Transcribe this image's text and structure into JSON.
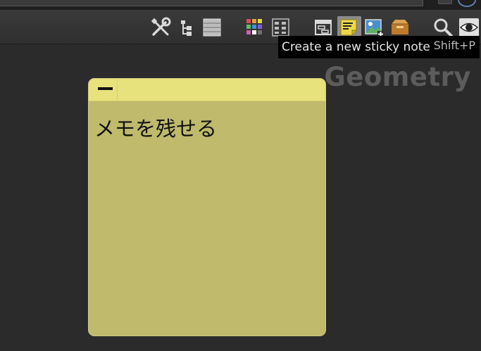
{
  "toolbar": {
    "icons": [
      {
        "name": "wrench-screwdriver-icon",
        "label": "Tools"
      },
      {
        "name": "tree-view-icon",
        "label": "Tree view"
      },
      {
        "name": "list-view-icon",
        "label": "List view"
      },
      {
        "name": "color-palette-icon",
        "label": "Color palette"
      },
      {
        "name": "shape-palette-icon",
        "label": "Shape palette"
      },
      {
        "name": "network-box-icon",
        "label": "Network box"
      },
      {
        "name": "sticky-note-icon",
        "label": "Sticky note",
        "active": true
      },
      {
        "name": "background-image-icon",
        "label": "Background image"
      },
      {
        "name": "package-box-icon",
        "label": "Package"
      },
      {
        "name": "magnifier-icon",
        "label": "Find"
      },
      {
        "name": "eye-icon",
        "label": "Display"
      }
    ]
  },
  "tooltip": {
    "text": "Create a new sticky note",
    "shortcut": "Shift+P"
  },
  "network": {
    "context_label": "Geometry"
  },
  "sticky_note": {
    "text": "メモを残せる",
    "header_color": "#e8e27c",
    "body_color": "#bfba6c"
  },
  "colors": {
    "background": "#2b2b2b",
    "toolbar": "#353535",
    "tooltip_bg": "#000000",
    "tooltip_text": "#e6e6e6",
    "context_label": "#5c5c5c"
  }
}
